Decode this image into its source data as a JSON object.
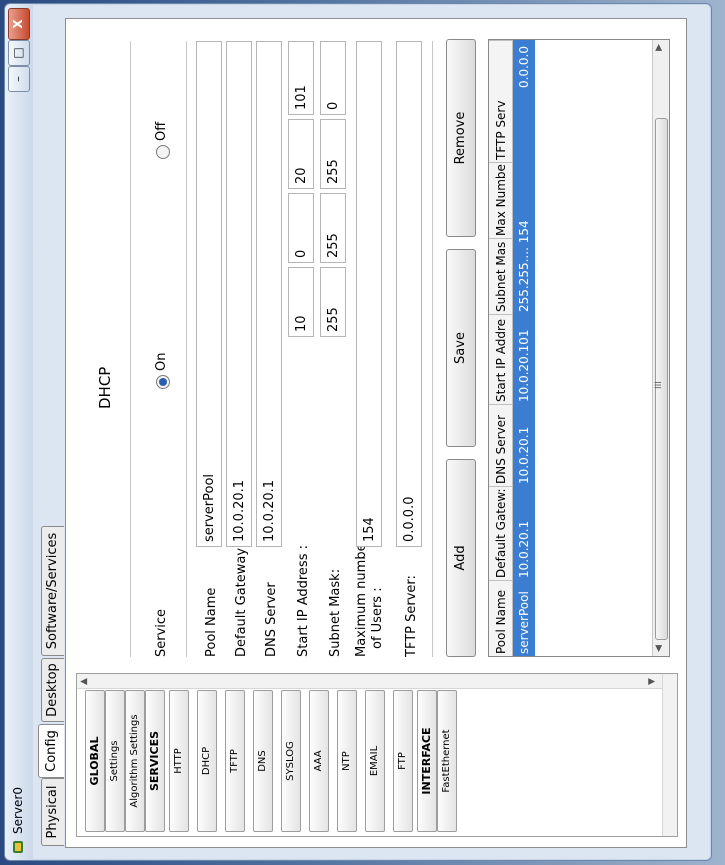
{
  "window": {
    "title": "Server0",
    "controls": {
      "minimize": "–",
      "maximize": "□",
      "close": "X"
    }
  },
  "tabs": [
    {
      "label": "Physical"
    },
    {
      "label": "Config"
    },
    {
      "label": "Desktop"
    },
    {
      "label": "Software/Services"
    }
  ],
  "active_tab": "Config",
  "sidebar": {
    "items": [
      {
        "label": "GLOBAL",
        "header": true
      },
      {
        "label": "Settings"
      },
      {
        "label": "Algorithm Settings"
      },
      {
        "label": "SERVICES",
        "header": true
      },
      {
        "label": "HTTP"
      },
      {
        "label": "DHCP"
      },
      {
        "label": "TFTP"
      },
      {
        "label": "DNS"
      },
      {
        "label": "SYSLOG"
      },
      {
        "label": "AAA"
      },
      {
        "label": "NTP"
      },
      {
        "label": "EMAIL"
      },
      {
        "label": "FTP"
      },
      {
        "label": "INTERFACE",
        "header": true
      },
      {
        "label": "FastEthernet"
      }
    ]
  },
  "dhcp": {
    "title": "DHCP",
    "service_label": "Service",
    "on_label": "On",
    "off_label": "Off",
    "service_selected": "On",
    "pool_name_label": "Pool Name",
    "pool_name": "serverPool",
    "gateway_label": "Default Gateway",
    "gateway": "10.0.20.1",
    "dns_label": "DNS Server",
    "dns": "10.0.20.1",
    "start_ip_label": "Start IP Address :",
    "start_ip": [
      "10",
      "0",
      "20",
      "101"
    ],
    "subnet_label": "Subnet Mask:",
    "subnet": [
      "255",
      "255",
      "255",
      "0"
    ],
    "max_users_label_1": "Maximum number",
    "max_users_label_2": "of Users :",
    "max_users": "154",
    "tftp_label": "TFTP Server:",
    "tftp": "0.0.0.0",
    "buttons": {
      "add": "Add",
      "save": "Save",
      "remove": "Remove"
    }
  },
  "table": {
    "columns": [
      "Pool Name",
      "Default Gatew:",
      "DNS Server",
      "Start IP Addre",
      "Subnet Mas",
      "Max Numbe",
      "TFTP Serv"
    ],
    "rows": [
      [
        "serverPool",
        "10.0.20.1",
        "10.0.20.1",
        "10.0.20.101",
        "255.255.... 154",
        "",
        "0.0.0.0"
      ]
    ],
    "scroll_thumb_label": "III"
  }
}
